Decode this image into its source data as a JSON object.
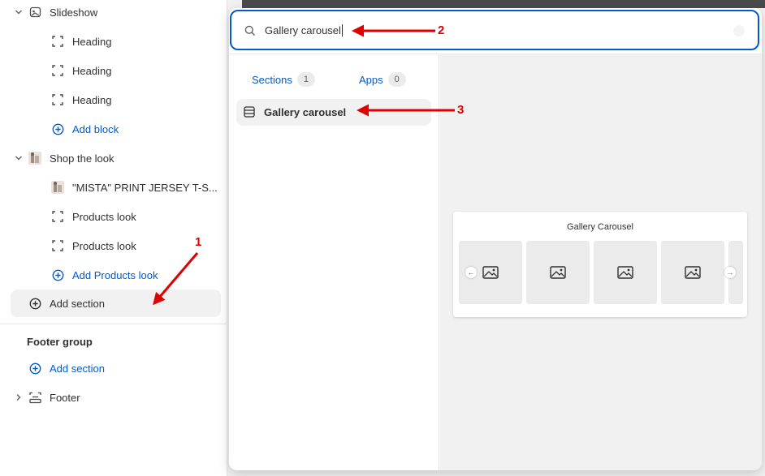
{
  "sidebar": {
    "items": [
      {
        "label": "Slideshow",
        "icon": "slideshow-icon",
        "expanded": true
      },
      {
        "label": "Heading",
        "icon": "block-icon"
      },
      {
        "label": "Heading",
        "icon": "block-icon"
      },
      {
        "label": "Heading",
        "icon": "block-icon"
      },
      {
        "label": "Add block",
        "icon": "plus-circle-icon"
      },
      {
        "label": "Shop the look",
        "icon": "image-thumbnail",
        "expanded": true
      },
      {
        "label": "\"MISTA\" PRINT JERSEY T-S...",
        "icon": "image-thumbnail"
      },
      {
        "label": "Products look",
        "icon": "block-icon"
      },
      {
        "label": "Products look",
        "icon": "block-icon"
      },
      {
        "label": "Add Products look",
        "icon": "plus-circle-icon"
      },
      {
        "label": "Add section",
        "icon": "plus-circle-icon"
      }
    ],
    "footer_group": {
      "title": "Footer group",
      "add_section": "Add section",
      "footer_label": "Footer"
    }
  },
  "popover": {
    "search": {
      "value": "Gallery carousel"
    },
    "tabs": [
      {
        "label": "Sections",
        "count": "1"
      },
      {
        "label": "Apps",
        "count": "0"
      }
    ],
    "results": [
      {
        "label": "Gallery carousel",
        "icon": "section-list-icon"
      }
    ],
    "preview": {
      "title": "Gallery Carousel",
      "slides": 4,
      "prev_arrow": "←",
      "next_arrow": "→"
    }
  },
  "annotations": [
    {
      "number": "1"
    },
    {
      "number": "2"
    },
    {
      "number": "3"
    }
  ],
  "colors": {
    "accent": "#005bd3",
    "annotation": "#e00000",
    "active_bg": "#f1f1f1"
  }
}
